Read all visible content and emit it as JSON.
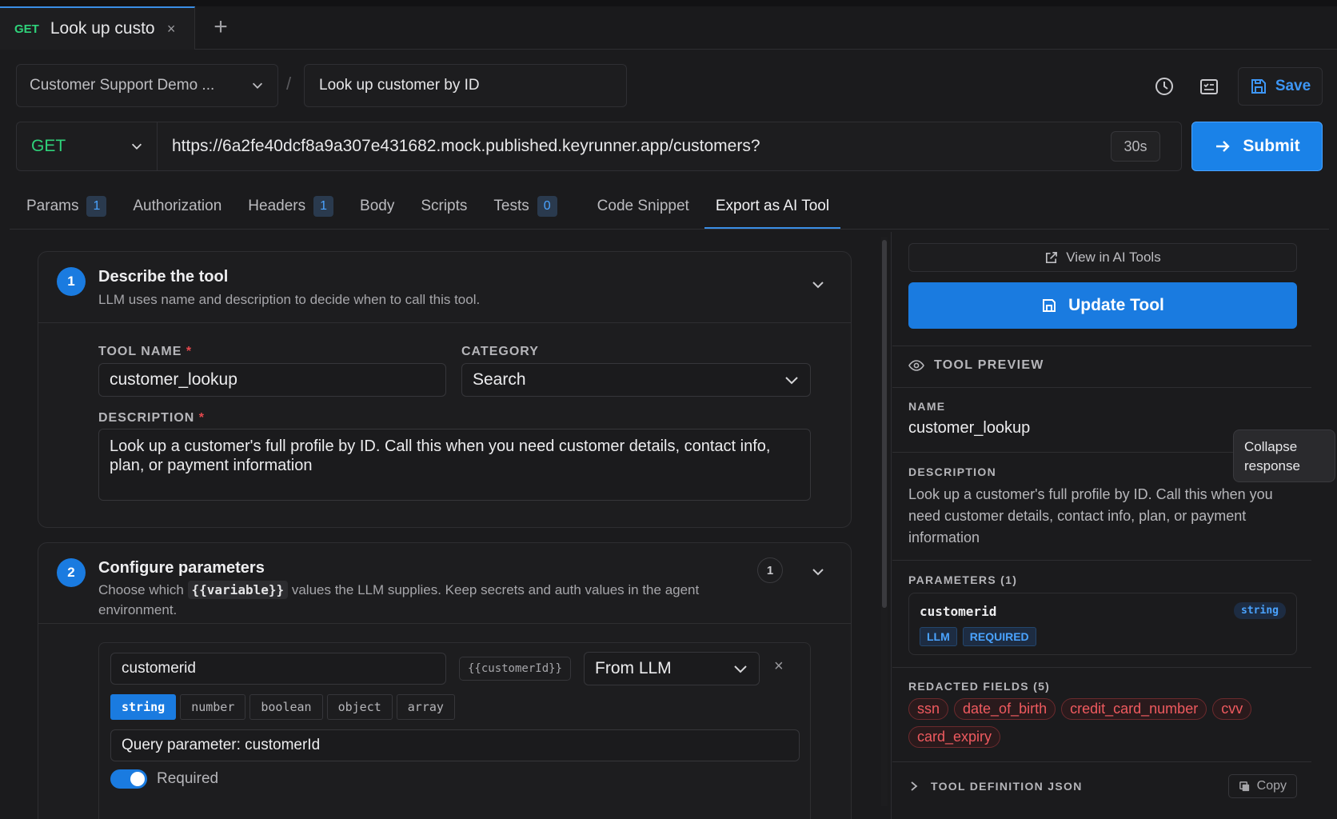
{
  "tab": {
    "method": "GET",
    "title": "Look up custo",
    "close": "×",
    "new_tab": "+"
  },
  "breadcrumb": {
    "collection": "Customer Support Demo ...",
    "separator": "/",
    "request_name": "Look up customer by ID"
  },
  "toolbar": {
    "save_label": "Save"
  },
  "request": {
    "method": "GET",
    "url": "https://6a2fe40dcf8a9a307e431682.mock.published.keyrunner.app/customers?",
    "timeout": "30s",
    "submit_label": "Submit"
  },
  "tabs": [
    {
      "label": "Params",
      "badge": "1"
    },
    {
      "label": "Authorization",
      "badge": null
    },
    {
      "label": "Headers",
      "badge": "1"
    },
    {
      "label": "Body",
      "badge": null
    },
    {
      "label": "Scripts",
      "badge": null
    },
    {
      "label": "Tests",
      "badge": "0"
    },
    {
      "label": "Code Snippet",
      "badge": null
    },
    {
      "label": "Export as AI Tool",
      "badge": null
    }
  ],
  "section1": {
    "step": "1",
    "title": "Describe the tool",
    "subtitle": "LLM uses name and description to decide when to call this tool.",
    "tool_name_label": "TOOL NAME",
    "tool_name_value": "customer_lookup",
    "category_label": "CATEGORY",
    "category_value": "Search",
    "description_label": "DESCRIPTION",
    "description_value": "Look up a customer's full profile by ID. Call this when you need customer details, contact info, plan, or payment information",
    "required_mark": "*"
  },
  "section2": {
    "step": "2",
    "title": "Configure parameters",
    "subtitle_pre": "Choose which",
    "subtitle_code": "{{variable}}",
    "subtitle_post": "values the LLM supplies. Keep secrets and auth values in the agent environment.",
    "count": "1",
    "param": {
      "name": "customerid",
      "variable": "{{customerId}}",
      "source": "From LLM",
      "remove": "×",
      "types": [
        "string",
        "number",
        "boolean",
        "object",
        "array"
      ],
      "selected_type": "string",
      "description": "Query parameter: customerId",
      "required_label": "Required",
      "required": true
    }
  },
  "preview": {
    "view_label": "View in AI Tools",
    "update_label": "Update Tool",
    "header": "TOOL PREVIEW",
    "name_label": "NAME",
    "name_value": "customer_lookup",
    "description_label": "DESCRIPTION",
    "description_value": "Look up a customer's full profile by ID. Call this when you need customer details, contact info, plan, or payment information",
    "parameters_label": "PARAMETERS (1)",
    "param_name": "customerid",
    "param_type": "string",
    "param_tags": [
      "LLM",
      "REQUIRED"
    ],
    "redacted_label": "REDACTED FIELDS (5)",
    "redacted": [
      "ssn",
      "date_of_birth",
      "credit_card_number",
      "cvv",
      "card_expiry"
    ],
    "json_label": "TOOL DEFINITION JSON",
    "copy_label": "Copy"
  },
  "tooltip": {
    "text": "Collapse response"
  },
  "colors": {
    "accent": "#1a7be0",
    "get_method": "#2fd27a",
    "redacted": "#ef5a5f"
  }
}
